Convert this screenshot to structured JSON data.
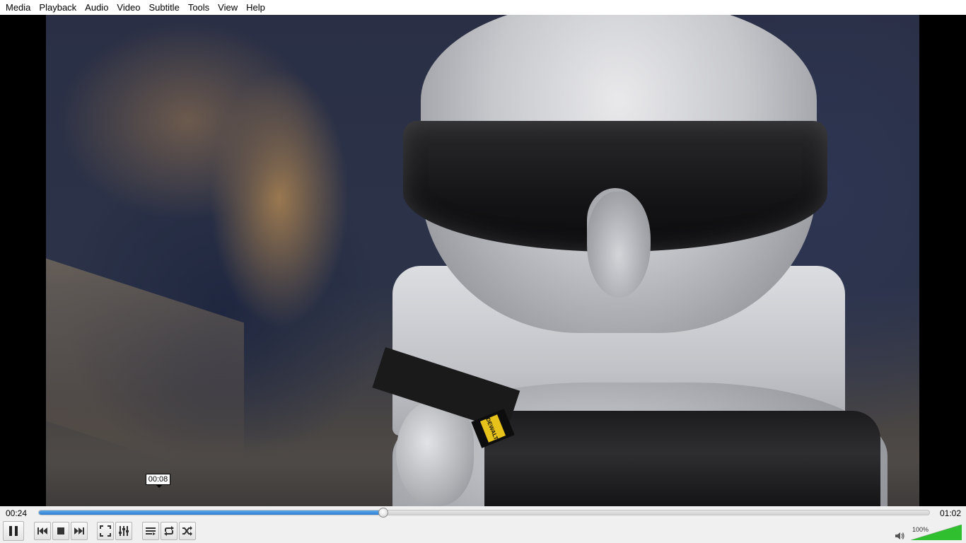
{
  "menu": {
    "items": [
      "Media",
      "Playback",
      "Audio",
      "Video",
      "Subtitle",
      "Tools",
      "View",
      "Help"
    ]
  },
  "video": {
    "overlay_brand": "DEWALT"
  },
  "seekbar": {
    "elapsed": "00:24",
    "total": "01:02",
    "hover_time": "00:08",
    "progress_fraction": 0.387
  },
  "controls": {
    "buttons": [
      {
        "name": "pause-button",
        "icon": "pause-icon"
      },
      {
        "name": "previous-button",
        "icon": "skip-previous-icon"
      },
      {
        "name": "stop-button",
        "icon": "stop-icon"
      },
      {
        "name": "next-button",
        "icon": "skip-next-icon"
      },
      {
        "name": "fullscreen-button",
        "icon": "fullscreen-icon"
      },
      {
        "name": "extended-settings-button",
        "icon": "equalizer-sliders-icon"
      },
      {
        "name": "playlist-button",
        "icon": "playlist-icon"
      },
      {
        "name": "loop-button",
        "icon": "loop-icon"
      },
      {
        "name": "shuffle-button",
        "icon": "shuffle-icon"
      }
    ]
  },
  "volume": {
    "label": "100%",
    "level_fraction": 1.0,
    "icon": "speaker-icon",
    "fill_color": "#2fbf2f"
  }
}
